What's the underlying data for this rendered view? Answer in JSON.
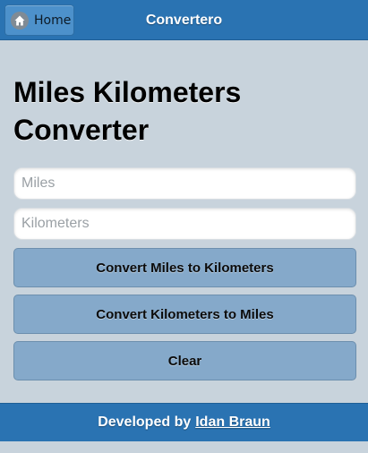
{
  "header": {
    "home_label": "Home",
    "home_icon": "home-icon",
    "title": "Convertero"
  },
  "main": {
    "title": "Miles Kilometers Converter",
    "miles": {
      "value": "",
      "placeholder": "Miles"
    },
    "kilometers": {
      "value": "",
      "placeholder": "Kilometers"
    },
    "buttons": {
      "to_km": "Convert Miles to Kilometers",
      "to_miles": "Convert Kilometers to Miles",
      "clear": "Clear"
    }
  },
  "footer": {
    "prefix": "Developed by",
    "author": "Idan Braun"
  },
  "colors": {
    "header_bg": "#2a73b2",
    "page_bg": "#c8d3dc",
    "button_bg": "#85a9ca"
  }
}
